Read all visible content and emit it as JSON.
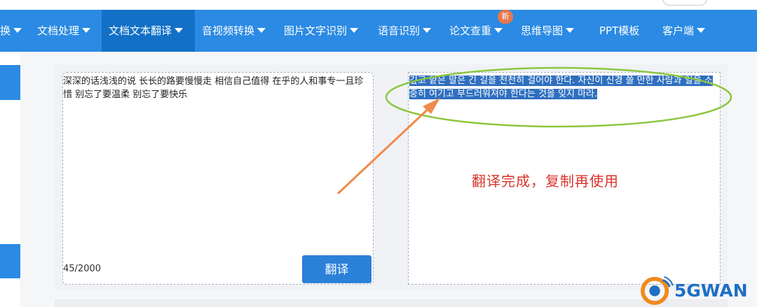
{
  "nav": {
    "items": [
      {
        "label": "换"
      },
      {
        "label": "文档处理"
      },
      {
        "label": "文档文本翻译"
      },
      {
        "label": "音视频转换"
      },
      {
        "label": "图片文字识别"
      },
      {
        "label": "语音识别"
      },
      {
        "label": "论文查重"
      },
      {
        "label": "思维导图"
      },
      {
        "label": "PPT模板"
      },
      {
        "label": "客户端"
      }
    ],
    "badge": "新",
    "active_color": "#1270c6",
    "bar_color": "#2b8ae3"
  },
  "source": {
    "text": "深深的话浅浅的说 长长的路要慢慢走 相信自己值得 在乎的人和事专一且珍惜 别忘了要温柔 别忘了要快乐",
    "counter": "45/2000"
  },
  "translate_button": {
    "label": "翻译"
  },
  "result": {
    "text": "깊고 얕은 말은 긴 길을 천천히 걸어야 한다. 자신이 신경 쓸 만한 사람과 일을 소중히 여기고 부드러워져야 한다는 것을 잊지 마라.",
    "highlight_color": "#2f6fbf"
  },
  "annotation": {
    "text": "翻译完成，复制再使用",
    "color": "#d9322b",
    "arrow_color": "#f08a4b",
    "ellipse_color": "#8cc63f"
  },
  "watermark": {
    "text": "5GWAN",
    "color": "#1f6fc4"
  }
}
